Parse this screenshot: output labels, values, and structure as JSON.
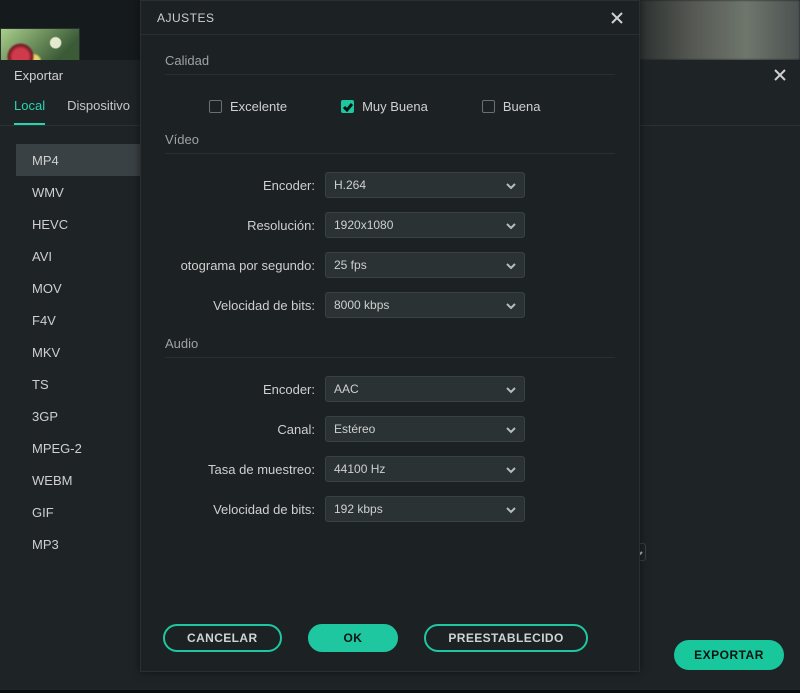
{
  "background": {
    "thumbnail_alt": "video-thumbnail"
  },
  "export": {
    "title": "Exportar",
    "tabs": {
      "local": "Local",
      "device": "Dispositivo"
    },
    "formats": [
      "MP4",
      "WMV",
      "HEVC",
      "AVI",
      "MOV",
      "F4V",
      "MKV",
      "TS",
      "3GP",
      "MPEG-2",
      "WEBM",
      "GIF",
      "MP3"
    ],
    "selected_format_index": 0,
    "export_btn": "EXPORTAR"
  },
  "modal": {
    "title": "AJUSTES",
    "sections": {
      "quality": {
        "label": "Calidad",
        "options": {
          "excellent": "Excelente",
          "very_good": "Muy Buena",
          "good": "Buena"
        },
        "selected": "very_good"
      },
      "video": {
        "label": "Vídeo",
        "encoder_label": "Encoder:",
        "encoder_value": "H.264",
        "resolution_label": "Resolución:",
        "resolution_value": "1920x1080",
        "fps_label": "otograma por segundo:",
        "fps_value": "25 fps",
        "bitrate_label": "Velocidad de bits:",
        "bitrate_value": "8000 kbps"
      },
      "audio": {
        "label": "Audio",
        "encoder_label": "Encoder:",
        "encoder_value": "AAC",
        "channel_label": "Canal:",
        "channel_value": "Estéreo",
        "samplerate_label": "Tasa de muestreo:",
        "samplerate_value": "44100 Hz",
        "bitrate_label": "Velocidad de bits:",
        "bitrate_value": "192 kbps"
      }
    },
    "buttons": {
      "cancel": "CANCELAR",
      "ok": "OK",
      "preset": "PREESTABLECIDO"
    }
  }
}
